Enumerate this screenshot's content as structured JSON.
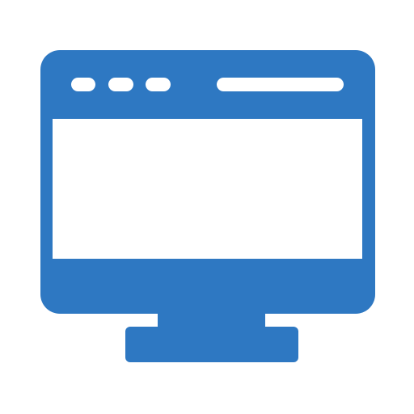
{
  "icon": {
    "name": "desktop-monitor-browser-icon",
    "colors": {
      "primary": "#2E78C2",
      "screen": "#FFFFFF"
    },
    "window_controls_count": 3
  }
}
